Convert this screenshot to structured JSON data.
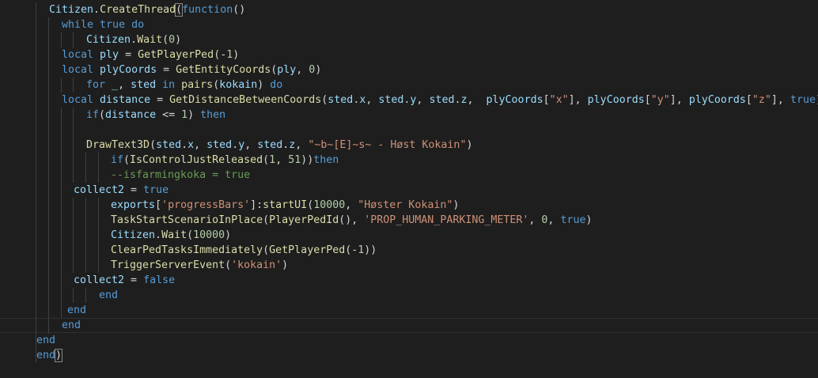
{
  "editor": {
    "language": "lua",
    "colors": {
      "background": "#1e1e1e",
      "ident": "#9cdcfe",
      "keyword": "#569cd6",
      "function": "#dcdcaa",
      "number": "#b5cea8",
      "string": "#ce9178",
      "comment": "#6a9955",
      "punct": "#d4d4d4"
    },
    "lines": [
      {
        "indent": 6,
        "guides": [
          4
        ],
        "tokens": [
          [
            "ident",
            "Citizen"
          ],
          [
            "p",
            "."
          ],
          [
            "fn",
            "CreateThread"
          ],
          [
            "br",
            "("
          ],
          [
            "kw",
            "function"
          ],
          [
            "p",
            "()"
          ]
        ]
      },
      {
        "indent": 8,
        "guides": [
          4,
          6
        ],
        "tokens": [
          [
            "kw",
            "while"
          ],
          [
            "p",
            " "
          ],
          [
            "kw",
            "true"
          ],
          [
            "p",
            " "
          ],
          [
            "kw",
            "do"
          ]
        ]
      },
      {
        "indent": 12,
        "guides": [
          4,
          6,
          8,
          10
        ],
        "tokens": [
          [
            "ident",
            "Citizen"
          ],
          [
            "p",
            "."
          ],
          [
            "fn",
            "Wait"
          ],
          [
            "p",
            "("
          ],
          [
            "num",
            "0"
          ],
          [
            "p",
            ")"
          ]
        ]
      },
      {
        "indent": 8,
        "guides": [
          4,
          6
        ],
        "tokens": [
          [
            "kw",
            "local"
          ],
          [
            "p",
            " "
          ],
          [
            "ident",
            "ply"
          ],
          [
            "p",
            " = "
          ],
          [
            "fn",
            "GetPlayerPed"
          ],
          [
            "p",
            "(-"
          ],
          [
            "num",
            "1"
          ],
          [
            "p",
            ")"
          ]
        ]
      },
      {
        "indent": 8,
        "guides": [
          4,
          6
        ],
        "tokens": [
          [
            "kw",
            "local"
          ],
          [
            "p",
            " "
          ],
          [
            "ident",
            "plyCoords"
          ],
          [
            "p",
            " = "
          ],
          [
            "fn",
            "GetEntityCoords"
          ],
          [
            "p",
            "("
          ],
          [
            "ident",
            "ply"
          ],
          [
            "p",
            ", "
          ],
          [
            "num",
            "0"
          ],
          [
            "p",
            ")"
          ]
        ]
      },
      {
        "indent": 12,
        "guides": [
          4,
          6,
          8,
          10
        ],
        "tokens": [
          [
            "kw",
            "for"
          ],
          [
            "p",
            " "
          ],
          [
            "ident",
            "_"
          ],
          [
            "p",
            ", "
          ],
          [
            "ident",
            "sted"
          ],
          [
            "p",
            " "
          ],
          [
            "kw",
            "in"
          ],
          [
            "p",
            " "
          ],
          [
            "fn",
            "pairs"
          ],
          [
            "p",
            "("
          ],
          [
            "ident",
            "kokain"
          ],
          [
            "p",
            ") "
          ],
          [
            "kw",
            "do"
          ]
        ]
      },
      {
        "indent": 8,
        "guides": [
          4,
          6
        ],
        "tokens": [
          [
            "kw",
            "local"
          ],
          [
            "p",
            " "
          ],
          [
            "ident",
            "distance"
          ],
          [
            "p",
            " = "
          ],
          [
            "fn",
            "GetDistanceBetweenCoords"
          ],
          [
            "p",
            "("
          ],
          [
            "ident",
            "sted"
          ],
          [
            "p",
            "."
          ],
          [
            "ident",
            "x"
          ],
          [
            "p",
            ", "
          ],
          [
            "ident",
            "sted"
          ],
          [
            "p",
            "."
          ],
          [
            "ident",
            "y"
          ],
          [
            "p",
            ", "
          ],
          [
            "ident",
            "sted"
          ],
          [
            "p",
            "."
          ],
          [
            "ident",
            "z"
          ],
          [
            "p",
            ",  "
          ],
          [
            "ident",
            "plyCoords"
          ],
          [
            "p",
            "["
          ],
          [
            "str",
            "\"x\""
          ],
          [
            "p",
            "], "
          ],
          [
            "ident",
            "plyCoords"
          ],
          [
            "p",
            "["
          ],
          [
            "str",
            "\"y\""
          ],
          [
            "p",
            "], "
          ],
          [
            "ident",
            "plyCoords"
          ],
          [
            "p",
            "["
          ],
          [
            "str",
            "\"z\""
          ],
          [
            "p",
            "], "
          ],
          [
            "kw",
            "true"
          ],
          [
            "p",
            ")"
          ]
        ]
      },
      {
        "indent": 12,
        "guides": [
          4,
          6,
          8,
          10
        ],
        "tokens": [
          [
            "kw",
            "if"
          ],
          [
            "p",
            "("
          ],
          [
            "ident",
            "distance"
          ],
          [
            "p",
            " <= "
          ],
          [
            "num",
            "1"
          ],
          [
            "p",
            ") "
          ],
          [
            "kw",
            "then"
          ]
        ]
      },
      {
        "indent": 0,
        "guides": [
          4,
          6,
          8,
          10
        ],
        "tokens": []
      },
      {
        "indent": 12,
        "guides": [
          4,
          6,
          8,
          10
        ],
        "tokens": [
          [
            "fn",
            "DrawText3D"
          ],
          [
            "p",
            "("
          ],
          [
            "ident",
            "sted"
          ],
          [
            "p",
            "."
          ],
          [
            "ident",
            "x"
          ],
          [
            "p",
            ", "
          ],
          [
            "ident",
            "sted"
          ],
          [
            "p",
            "."
          ],
          [
            "ident",
            "y"
          ],
          [
            "p",
            ", "
          ],
          [
            "ident",
            "sted"
          ],
          [
            "p",
            "."
          ],
          [
            "ident",
            "z"
          ],
          [
            "p",
            ", "
          ],
          [
            "str",
            "\"~b~[E]~s~ - Høst Kokain\""
          ],
          [
            "p",
            ")"
          ]
        ]
      },
      {
        "indent": 16,
        "guides": [
          4,
          6,
          8,
          10,
          12,
          14
        ],
        "tokens": [
          [
            "kw",
            "if"
          ],
          [
            "p",
            "("
          ],
          [
            "fn",
            "IsControlJustReleased"
          ],
          [
            "p",
            "("
          ],
          [
            "num",
            "1"
          ],
          [
            "p",
            ", "
          ],
          [
            "num",
            "51"
          ],
          [
            "p",
            "))"
          ],
          [
            "kw",
            "then"
          ]
        ]
      },
      {
        "indent": 16,
        "guides": [
          4,
          6,
          8,
          10,
          12,
          14
        ],
        "tokens": [
          [
            "cmt",
            "--isfarmingkoka = true"
          ]
        ]
      },
      {
        "indent": 10,
        "guides": [
          4,
          6,
          8
        ],
        "tokens": [
          [
            "ident",
            "collect2"
          ],
          [
            "p",
            " = "
          ],
          [
            "kw",
            "true"
          ]
        ]
      },
      {
        "indent": 16,
        "guides": [
          4,
          6,
          8,
          10,
          12,
          14
        ],
        "tokens": [
          [
            "ident",
            "exports"
          ],
          [
            "p",
            "["
          ],
          [
            "str",
            "'progressBars'"
          ],
          [
            "p",
            "]:"
          ],
          [
            "fn",
            "startUI"
          ],
          [
            "p",
            "("
          ],
          [
            "num",
            "10000"
          ],
          [
            "p",
            ", "
          ],
          [
            "str",
            "\"Høster Kokain\""
          ],
          [
            "p",
            ")"
          ]
        ]
      },
      {
        "indent": 16,
        "guides": [
          4,
          6,
          8,
          10,
          12,
          14
        ],
        "tokens": [
          [
            "fn",
            "TaskStartScenarioInPlace"
          ],
          [
            "p",
            "("
          ],
          [
            "fn",
            "PlayerPedId"
          ],
          [
            "p",
            "(), "
          ],
          [
            "str",
            "'PROP_HUMAN_PARKING_METER'"
          ],
          [
            "p",
            ", "
          ],
          [
            "num",
            "0"
          ],
          [
            "p",
            ", "
          ],
          [
            "kw",
            "true"
          ],
          [
            "p",
            ")"
          ]
        ]
      },
      {
        "indent": 16,
        "guides": [
          4,
          6,
          8,
          10,
          12,
          14
        ],
        "tokens": [
          [
            "ident",
            "Citizen"
          ],
          [
            "p",
            "."
          ],
          [
            "fn",
            "Wait"
          ],
          [
            "p",
            "("
          ],
          [
            "num",
            "10000"
          ],
          [
            "p",
            ")"
          ]
        ]
      },
      {
        "indent": 16,
        "guides": [
          4,
          6,
          8,
          10,
          12,
          14
        ],
        "tokens": [
          [
            "fn",
            "ClearPedTasksImmediately"
          ],
          [
            "p",
            "("
          ],
          [
            "fn",
            "GetPlayerPed"
          ],
          [
            "p",
            "(-"
          ],
          [
            "num",
            "1"
          ],
          [
            "p",
            "))"
          ]
        ]
      },
      {
        "indent": 16,
        "guides": [
          4,
          6,
          8,
          10,
          12,
          14
        ],
        "tokens": [
          [
            "fn",
            "TriggerServerEvent"
          ],
          [
            "p",
            "("
          ],
          [
            "str",
            "'kokain'"
          ],
          [
            "p",
            ")"
          ]
        ]
      },
      {
        "indent": 10,
        "guides": [
          4,
          6,
          8
        ],
        "tokens": [
          [
            "ident",
            "collect2"
          ],
          [
            "p",
            " = "
          ],
          [
            "kw",
            "false"
          ]
        ]
      },
      {
        "indent": 14,
        "guides": [
          4,
          6,
          8,
          10,
          12
        ],
        "tokens": [
          [
            "kw",
            "end"
          ]
        ]
      },
      {
        "indent": 9,
        "guides": [
          4,
          6,
          8
        ],
        "tokens": [
          [
            "kw",
            "end"
          ]
        ]
      },
      {
        "indent": 8,
        "guides": [
          4,
          6
        ],
        "tokens": [
          [
            "kw",
            "end"
          ]
        ],
        "current": true
      },
      {
        "indent": 4,
        "guides": [
          4
        ],
        "tokens": [
          [
            "kw",
            "end"
          ]
        ]
      },
      {
        "indent": 4,
        "guides": [
          4
        ],
        "tokens": [
          [
            "kw",
            "end"
          ],
          [
            "br",
            ")"
          ]
        ]
      }
    ]
  }
}
